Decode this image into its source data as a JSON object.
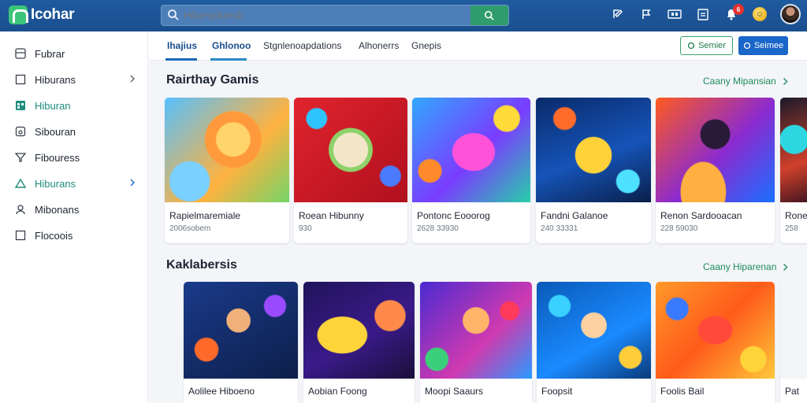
{
  "header": {
    "logo_text": "Icohar",
    "search_placeholder": "Hibenpikersh",
    "notification_count": "6",
    "coin_symbol": "☺"
  },
  "sidebar": {
    "items": [
      {
        "label": "Fubrar",
        "icon": "grid-icon",
        "chevron": false,
        "active": false
      },
      {
        "label": "Hiburans",
        "icon": "square-icon",
        "chevron": true,
        "active": false
      },
      {
        "label": "Hiburan",
        "icon": "calendar-icon",
        "chevron": false,
        "active": true
      },
      {
        "label": "Sibouran",
        "icon": "gamepad-icon",
        "chevron": false,
        "active": false
      },
      {
        "label": "Fibouress",
        "icon": "filter-icon",
        "chevron": false,
        "active": false
      },
      {
        "label": "Hiburans",
        "icon": "home-icon",
        "chevron": true,
        "active": true
      },
      {
        "label": "Mibonans",
        "icon": "user-icon",
        "chevron": false,
        "active": false
      },
      {
        "label": "Flocoois",
        "icon": "box-icon",
        "chevron": false,
        "active": false
      }
    ]
  },
  "tabs": [
    {
      "label": "Ihajius",
      "active": true
    },
    {
      "label": "Ghlonoo",
      "active": true
    },
    {
      "label": "Stgnlenoapdations",
      "active": false
    },
    {
      "label": "Alhonerrs",
      "active": false
    },
    {
      "label": "Gnepis",
      "active": false
    }
  ],
  "actions": {
    "outline_label": "Semier",
    "primary_label": "Seimee"
  },
  "sections": [
    {
      "title": "Rairthay Gamis",
      "see_more": "Caany Mipansian",
      "cards": [
        {
          "name": "Rapielmaremiale",
          "meta": "2006sobem"
        },
        {
          "name": "Roean Hibunny",
          "meta": "930"
        },
        {
          "name": "Pontonc Eooorog",
          "meta": "2628 33930"
        },
        {
          "name": "Fandni Galanoe",
          "meta": "240 33331"
        },
        {
          "name": "Renon Sardooacan",
          "meta": "228 59030"
        },
        {
          "name": "Rone",
          "meta": "258"
        }
      ]
    },
    {
      "title": "Kaklabersis",
      "see_more": "Caany Hiparenan",
      "cards": [
        {
          "name": "Aolilee Hiboeno",
          "meta": ""
        },
        {
          "name": "Aobian Foong",
          "meta": ""
        },
        {
          "name": "Moopi Saaurs",
          "meta": ""
        },
        {
          "name": "Foopsit",
          "meta": ""
        },
        {
          "name": "Foolis Bail",
          "meta": ""
        },
        {
          "name": "Pat",
          "meta": ""
        }
      ]
    }
  ],
  "colors": {
    "topbar": "#1a4f8e",
    "accent_green": "#1f8d5f",
    "primary_blue": "#1a66c9"
  }
}
